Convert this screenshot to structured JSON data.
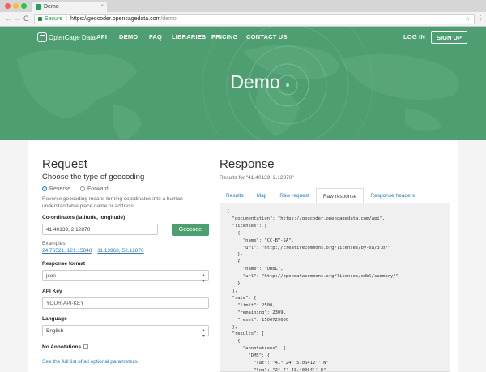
{
  "browser": {
    "tab_title": "Demo",
    "tab_close": "×",
    "secure_label": "Secure",
    "url_host": "https://geocoder.opencagedata.com",
    "url_path": "/demo",
    "back": "←",
    "forward": "→",
    "reload": "C",
    "star": "☆",
    "menu": "⋮"
  },
  "nav": {
    "logo_text": "OpenCage Data",
    "links": [
      "API",
      "DEMO",
      "FAQ",
      "LIBRARIES",
      "PRICING",
      "CONTACT US"
    ],
    "login": "LOG IN",
    "signup": "SIGN UP"
  },
  "hero": {
    "title": "Demo"
  },
  "request": {
    "heading": "Request",
    "subheading": "Choose the type of geocoding",
    "radio_reverse": "Reverse",
    "radio_forward": "Forward",
    "selected": "Reverse",
    "description_line1": "Reverse geocoding means turning coordinates into a human",
    "description_line2": "understandable place name or address.",
    "coords_label": "Co-ordinates (latitude, longitude)",
    "coords_value": "41.40139, 2.12870",
    "geocode_button": "Geocode",
    "examples_label": "Examples:",
    "example_1": "24.76521, 121.15848",
    "example_2": "11.13968, 52.12870",
    "format_label": "Response format",
    "format_value": "json",
    "apikey_label": "API Key",
    "apikey_value": "YOUR-API-KEY",
    "language_label": "Language",
    "language_value": "English",
    "no_annotations_label": "No Annotations",
    "optional_params_link": "See the full list of all optional parameters."
  },
  "response": {
    "heading": "Response",
    "results_for": "Results for \"41.40139, 2.12870\"",
    "tabs": [
      "Results",
      "Map",
      "Raw request",
      "Raw response",
      "Response headers"
    ],
    "active_tab": "Raw response",
    "raw": "{\n  \"documentation\": \"https://geocoder.opencagedata.com/api\",\n  \"licenses\": [\n    {\n      \"name\": \"CC-BY-SA\",\n      \"url\": \"http://creativecommons.org/licenses/by-sa/3.0/\"\n    },\n    {\n      \"name\": \"ODbL\",\n      \"url\": \"http://opendatacommons.org/licenses/odbl/summary/\"\n    }\n  ],\n  \"rate\": {\n    \"limit\": 2500,\n    \"remaining\": 2309,\n    \"reset\": 1506729600\n  },\n  \"results\": [\n    {\n      \"annotations\": {\n        \"DMS\": {\n          \"lat\": \"41° 24' 5.06412'' N\",\n          \"lng\": \"2° 7' 43.40064'' E\"\n        },"
  },
  "colors": {
    "brand_green": "#4f9e72",
    "link_blue": "#2a7ab8"
  }
}
